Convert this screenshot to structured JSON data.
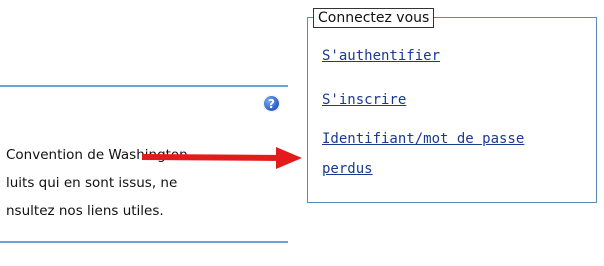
{
  "colors": {
    "link": "#1a3a8f",
    "rule": "#6aa4d6",
    "box_border": "#5a8ab8",
    "arrow": "#e21b1b"
  },
  "left_panel": {
    "help_icon_glyph": "?",
    "lines": [
      "Convention de Washington",
      "luits qui en sont issus, ne",
      "nsultez nos liens utiles."
    ]
  },
  "login_box": {
    "legend": "Connectez vous",
    "links": [
      "S'authentifier",
      "S'inscrire",
      "Identifiant/mot de passe",
      "perdus"
    ]
  },
  "annotation": {
    "icon": "red-arrow-icon"
  }
}
